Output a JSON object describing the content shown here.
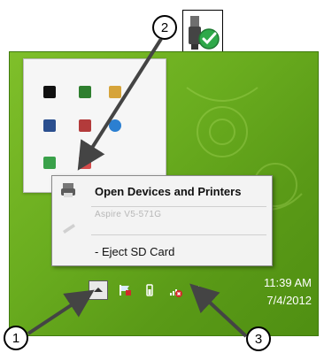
{
  "menu": {
    "open_devices_label": "Open Devices and Printers",
    "device_name": "Aspire V5-571G",
    "eject_label": "- Eject SD Card"
  },
  "clock": {
    "time": "11:39 AM",
    "date": "7/4/2012"
  },
  "callouts": {
    "one": "1",
    "two": "2",
    "three": "3"
  },
  "icons": {
    "safely_remove": "usb-safely-remove-icon",
    "overflow": "chevron-up-icon",
    "action_center": "flag-icon",
    "power": "battery-icon",
    "network": "network-icon",
    "volume": "speaker-icon",
    "printer": "printer-icon",
    "device": "device-icon"
  },
  "colors": {
    "desktop": "#6aad1f",
    "menu_bg": "#f3f3f3"
  }
}
